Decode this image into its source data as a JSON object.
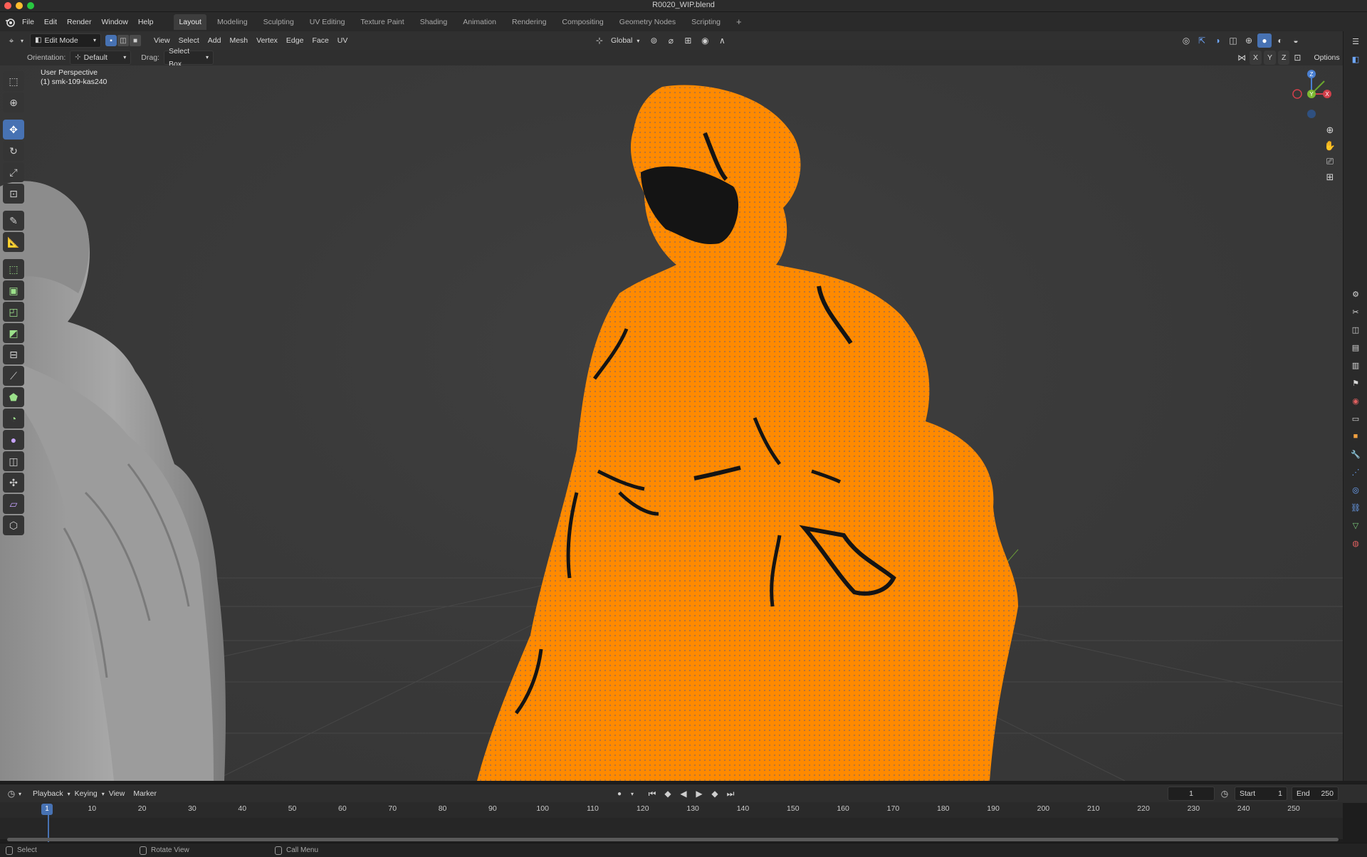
{
  "window": {
    "title": "R0020_WIP.blend"
  },
  "menubar": {
    "menus": [
      "File",
      "Edit",
      "Render",
      "Window",
      "Help"
    ],
    "workspaces": [
      "Layout",
      "Modeling",
      "Sculpting",
      "UV Editing",
      "Texture Paint",
      "Shading",
      "Animation",
      "Rendering",
      "Compositing",
      "Geometry Nodes",
      "Scripting"
    ],
    "active_workspace": "Layout",
    "add_tab": "+"
  },
  "header": {
    "mode": "Edit Mode",
    "menus": [
      "View",
      "Select",
      "Add",
      "Mesh",
      "Vertex",
      "Edge",
      "Face",
      "UV"
    ],
    "transform_orientation": "Global",
    "options_label": "Options",
    "axis_labels": [
      "X",
      "Y",
      "Z"
    ]
  },
  "tool_settings": {
    "orientation_label": "Orientation:",
    "orientation_value": "Default",
    "drag_label": "Drag:",
    "drag_value": "Select Box"
  },
  "viewport": {
    "view_name": "User Perspective",
    "object_name": "(1) smk-109-kas240",
    "gizmo_axes": {
      "z": "Z",
      "y": "Y",
      "x": "X"
    },
    "colors": {
      "selection": "#ff8a00",
      "background": "#3b3b3b",
      "grid": "#4a4a4a"
    }
  },
  "toolbar": {
    "tools": [
      "select-box",
      "cursor",
      "move",
      "rotate",
      "scale",
      "transform",
      "annotate",
      "measure",
      "add-cube",
      "extrude-region",
      "inset-faces",
      "bevel",
      "loop-cut",
      "knife",
      "poly-build",
      "spin",
      "smooth",
      "edge-slide",
      "shrink-fatten",
      "shear",
      "rip-region"
    ],
    "active_tool": "move"
  },
  "timeline": {
    "menus": [
      "Playback",
      "Keying",
      "View",
      "Marker"
    ],
    "current_frame": "1",
    "start_label": "Start",
    "start_value": "1",
    "end_label": "End",
    "end_value": "250",
    "ruler": [
      "1",
      "10",
      "20",
      "30",
      "40",
      "50",
      "60",
      "70",
      "80",
      "90",
      "100",
      "110",
      "120",
      "130",
      "140",
      "150",
      "160",
      "170",
      "180",
      "190",
      "200",
      "210",
      "220",
      "230",
      "240",
      "250"
    ]
  },
  "statusbar": {
    "items": [
      "Select",
      "Rotate View",
      "Call Menu"
    ]
  }
}
